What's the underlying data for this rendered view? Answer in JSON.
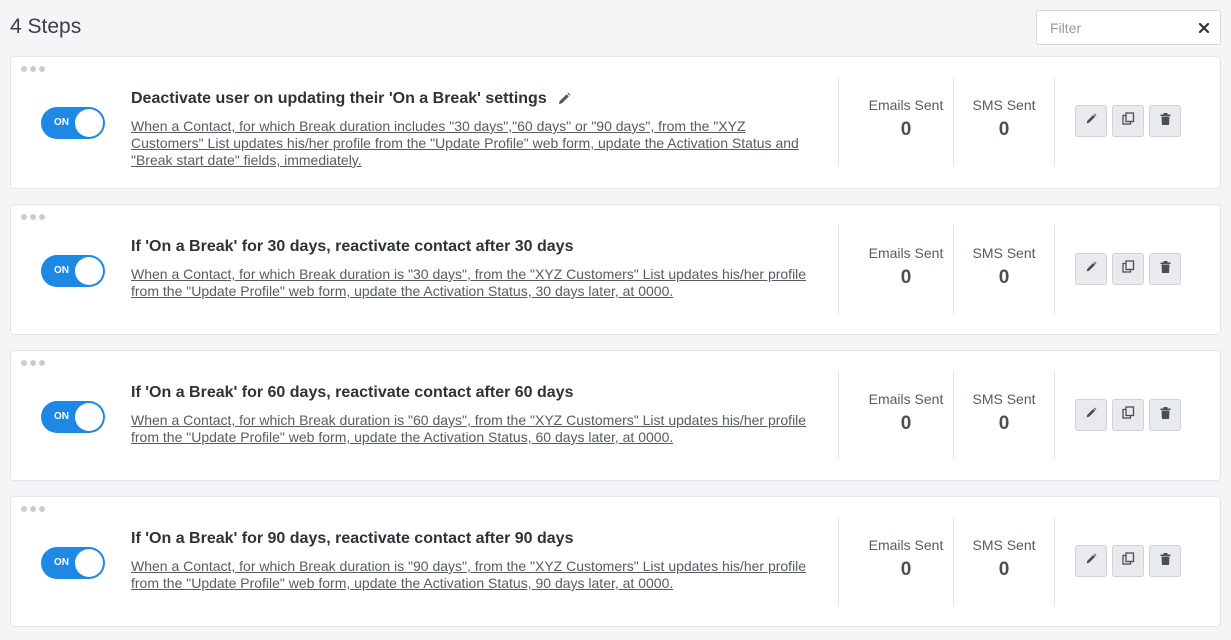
{
  "header": {
    "title": "4 Steps",
    "filter_placeholder": "Filter"
  },
  "labels": {
    "emails_sent": "Emails Sent",
    "sms_sent": "SMS Sent",
    "toggle_on": "ON"
  },
  "steps": [
    {
      "title": "Deactivate user on updating their 'On a Break' settings",
      "description": "When a Contact, for which Break duration includes \"30 days\",\"60 days\" or \"90 days\", from the \"XYZ Customers\" List updates his/her profile from the \"Update Profile\" web form, update the Activation Status and \"Break start date\" fields, immediately.",
      "emails_sent": "0",
      "sms_sent": "0",
      "enabled": true
    },
    {
      "title": "If 'On a Break' for 30 days, reactivate contact after 30 days",
      "description": "When a Contact, for which Break duration is \"30 days\", from the \"XYZ Customers\" List updates his/her profile from the \"Update Profile\" web form, update the Activation Status, 30 days later, at 0000.",
      "emails_sent": "0",
      "sms_sent": "0",
      "enabled": true
    },
    {
      "title": "If 'On a Break' for 60 days, reactivate contact after 60 days",
      "description": "When a Contact, for which Break duration is \"60 days\", from the \"XYZ Customers\" List updates his/her profile from the \"Update Profile\" web form, update the Activation Status, 60 days later, at 0000.",
      "emails_sent": "0",
      "sms_sent": "0",
      "enabled": true
    },
    {
      "title": "If 'On a Break' for 90 days, reactivate contact after 90 days",
      "description": "When a Contact, for which Break duration is \"90 days\", from the \"XYZ Customers\" List updates his/her profile from the \"Update Profile\" web form, update the Activation Status, 90 days later, at 0000.",
      "emails_sent": "0",
      "sms_sent": "0",
      "enabled": true
    }
  ],
  "icons": {
    "filter_clear": "close-icon",
    "drag": "drag-handle-icon",
    "edit": "pencil-icon",
    "copy": "copy-icon",
    "delete": "trash-icon"
  },
  "colors": {
    "toggle_on": "#1e88e5",
    "background": "#f4f5f7"
  }
}
